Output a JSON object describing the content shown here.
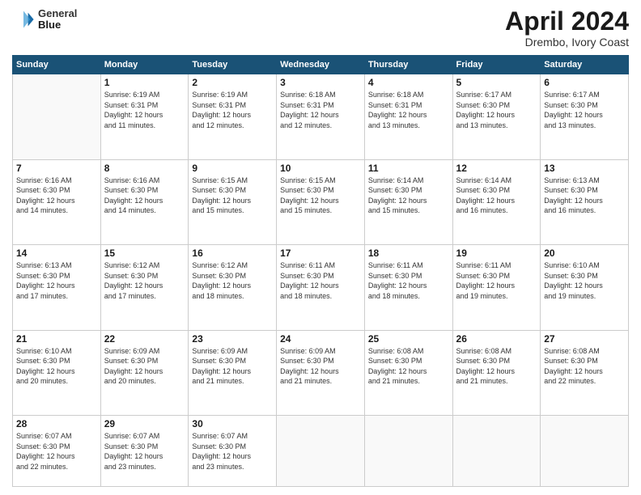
{
  "header": {
    "logo_line1": "General",
    "logo_line2": "Blue",
    "month": "April 2024",
    "location": "Drembo, Ivory Coast"
  },
  "weekdays": [
    "Sunday",
    "Monday",
    "Tuesday",
    "Wednesday",
    "Thursday",
    "Friday",
    "Saturday"
  ],
  "weeks": [
    [
      {
        "day": "",
        "info": ""
      },
      {
        "day": "1",
        "info": "Sunrise: 6:19 AM\nSunset: 6:31 PM\nDaylight: 12 hours\nand 11 minutes."
      },
      {
        "day": "2",
        "info": "Sunrise: 6:19 AM\nSunset: 6:31 PM\nDaylight: 12 hours\nand 12 minutes."
      },
      {
        "day": "3",
        "info": "Sunrise: 6:18 AM\nSunset: 6:31 PM\nDaylight: 12 hours\nand 12 minutes."
      },
      {
        "day": "4",
        "info": "Sunrise: 6:18 AM\nSunset: 6:31 PM\nDaylight: 12 hours\nand 13 minutes."
      },
      {
        "day": "5",
        "info": "Sunrise: 6:17 AM\nSunset: 6:30 PM\nDaylight: 12 hours\nand 13 minutes."
      },
      {
        "day": "6",
        "info": "Sunrise: 6:17 AM\nSunset: 6:30 PM\nDaylight: 12 hours\nand 13 minutes."
      }
    ],
    [
      {
        "day": "7",
        "info": "Sunrise: 6:16 AM\nSunset: 6:30 PM\nDaylight: 12 hours\nand 14 minutes."
      },
      {
        "day": "8",
        "info": "Sunrise: 6:16 AM\nSunset: 6:30 PM\nDaylight: 12 hours\nand 14 minutes."
      },
      {
        "day": "9",
        "info": "Sunrise: 6:15 AM\nSunset: 6:30 PM\nDaylight: 12 hours\nand 15 minutes."
      },
      {
        "day": "10",
        "info": "Sunrise: 6:15 AM\nSunset: 6:30 PM\nDaylight: 12 hours\nand 15 minutes."
      },
      {
        "day": "11",
        "info": "Sunrise: 6:14 AM\nSunset: 6:30 PM\nDaylight: 12 hours\nand 15 minutes."
      },
      {
        "day": "12",
        "info": "Sunrise: 6:14 AM\nSunset: 6:30 PM\nDaylight: 12 hours\nand 16 minutes."
      },
      {
        "day": "13",
        "info": "Sunrise: 6:13 AM\nSunset: 6:30 PM\nDaylight: 12 hours\nand 16 minutes."
      }
    ],
    [
      {
        "day": "14",
        "info": "Sunrise: 6:13 AM\nSunset: 6:30 PM\nDaylight: 12 hours\nand 17 minutes."
      },
      {
        "day": "15",
        "info": "Sunrise: 6:12 AM\nSunset: 6:30 PM\nDaylight: 12 hours\nand 17 minutes."
      },
      {
        "day": "16",
        "info": "Sunrise: 6:12 AM\nSunset: 6:30 PM\nDaylight: 12 hours\nand 18 minutes."
      },
      {
        "day": "17",
        "info": "Sunrise: 6:11 AM\nSunset: 6:30 PM\nDaylight: 12 hours\nand 18 minutes."
      },
      {
        "day": "18",
        "info": "Sunrise: 6:11 AM\nSunset: 6:30 PM\nDaylight: 12 hours\nand 18 minutes."
      },
      {
        "day": "19",
        "info": "Sunrise: 6:11 AM\nSunset: 6:30 PM\nDaylight: 12 hours\nand 19 minutes."
      },
      {
        "day": "20",
        "info": "Sunrise: 6:10 AM\nSunset: 6:30 PM\nDaylight: 12 hours\nand 19 minutes."
      }
    ],
    [
      {
        "day": "21",
        "info": "Sunrise: 6:10 AM\nSunset: 6:30 PM\nDaylight: 12 hours\nand 20 minutes."
      },
      {
        "day": "22",
        "info": "Sunrise: 6:09 AM\nSunset: 6:30 PM\nDaylight: 12 hours\nand 20 minutes."
      },
      {
        "day": "23",
        "info": "Sunrise: 6:09 AM\nSunset: 6:30 PM\nDaylight: 12 hours\nand 21 minutes."
      },
      {
        "day": "24",
        "info": "Sunrise: 6:09 AM\nSunset: 6:30 PM\nDaylight: 12 hours\nand 21 minutes."
      },
      {
        "day": "25",
        "info": "Sunrise: 6:08 AM\nSunset: 6:30 PM\nDaylight: 12 hours\nand 21 minutes."
      },
      {
        "day": "26",
        "info": "Sunrise: 6:08 AM\nSunset: 6:30 PM\nDaylight: 12 hours\nand 21 minutes."
      },
      {
        "day": "27",
        "info": "Sunrise: 6:08 AM\nSunset: 6:30 PM\nDaylight: 12 hours\nand 22 minutes."
      }
    ],
    [
      {
        "day": "28",
        "info": "Sunrise: 6:07 AM\nSunset: 6:30 PM\nDaylight: 12 hours\nand 22 minutes."
      },
      {
        "day": "29",
        "info": "Sunrise: 6:07 AM\nSunset: 6:30 PM\nDaylight: 12 hours\nand 23 minutes."
      },
      {
        "day": "30",
        "info": "Sunrise: 6:07 AM\nSunset: 6:30 PM\nDaylight: 12 hours\nand 23 minutes."
      },
      {
        "day": "",
        "info": ""
      },
      {
        "day": "",
        "info": ""
      },
      {
        "day": "",
        "info": ""
      },
      {
        "day": "",
        "info": ""
      }
    ]
  ]
}
